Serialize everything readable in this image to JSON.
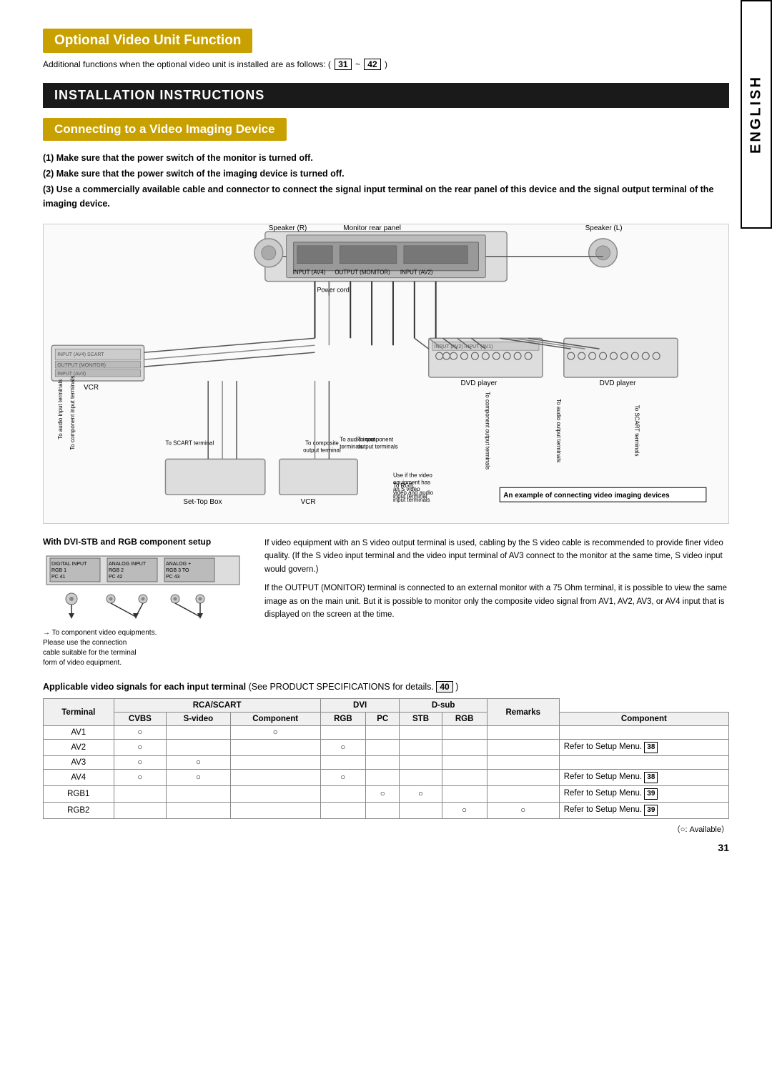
{
  "page": {
    "number": "31",
    "sidebar_label": "ENGLISH"
  },
  "optional_header": {
    "title": "Optional Video Unit Function",
    "subtitle": "Additional functions when the optional video unit is installed are as follows: (",
    "badge1": "31",
    "tilde": " ~ ",
    "badge2": "42",
    "suffix": " )"
  },
  "installation": {
    "title": "INSTALLATION INSTRUCTIONS"
  },
  "connecting": {
    "title": "Connecting to a Video Imaging Device"
  },
  "instructions": [
    "(1) Make sure that the power switch of the monitor is turned off.",
    "(2) Make sure that the power switch of the imaging device is turned off.",
    "(3) Use a commercially available cable and connector to connect the signal input terminal on the rear panel of this device and the signal output terminal of the imaging device."
  ],
  "diagram": {
    "caption": "An example of connecting video imaging devices",
    "labels": {
      "speaker_r": "Speaker (R)",
      "monitor_rear": "Monitor rear panel",
      "speaker_l": "Speaker (L)",
      "power": "Power cord",
      "dvd_player1": "DVD player",
      "dvd_player2": "DVD player",
      "vcr1": "VCR",
      "vcr2": "VCR",
      "set_top_box": "Set-Top Box",
      "to_audio_input": "To audio input terminals",
      "to_component1": "To component input terminals",
      "to_component2": "To component output terminals",
      "to_audio_output": "To audio output terminals",
      "to_scart1": "To SCART terminal",
      "to_scart2": "To SCART terminals",
      "to_rgb": "To RGB, video and audio input terminals",
      "to_composite": "To composite output terminal",
      "to_audio_input2": "To audio input terminals",
      "use_if": "Use if the video equipment has an S video input terminal"
    }
  },
  "dvi_stb": {
    "title": "With DVI-STB and RGB component setup",
    "inputs": [
      {
        "label": "DIGITAL INPUT\nRGB 1\nPC 41"
      },
      {
        "label": "ANALOG INPUT\nRGB 2\nPC 42"
      },
      {
        "label": "ANALOG +\nRGB 3 TO\nPC 43"
      }
    ],
    "component_label": "To component video equipments.\nPlease use the connection\ncable suitable for the terminal\nform of video equipment.",
    "notes": [
      "If video equipment with an S video output terminal is used, cabling by the S video cable is recommended to provide finer video quality. (If the S video input terminal and the video input terminal of AV3 connect to the monitor at the same time, S video input would govern.)",
      "If the OUTPUT (MONITOR) terminal is connected to an external monitor with a 75 Ohm terminal, it is possible to view the same image as on the main unit. But it is possible to monitor only the composite video signal from AV1, AV2, AV3, or AV4 input that is displayed on the screen at the time."
    ]
  },
  "applicable": {
    "text": "Applicable video signals for each input terminal",
    "see": "(See PRODUCT SPECIFICATIONS for details.",
    "badge": "40",
    "suffix": ")"
  },
  "table": {
    "columns": {
      "terminal": "Terminal",
      "rca_scart": "RCA/SCART",
      "dvi": "DVI",
      "dsub": "D-sub",
      "remarks": "Remarks"
    },
    "sub_columns": {
      "cvbs": "CVBS",
      "svideo": "S-video",
      "component": "Component",
      "rgb_rca": "RGB",
      "pc": "PC",
      "stb": "STB",
      "rgb_dsub": "RGB",
      "component_dsub": "Component"
    },
    "rows": [
      {
        "terminal": "AV1",
        "cvbs": "○",
        "svideo": "",
        "component_rca": "○",
        "rgb_rca": "",
        "pc": "",
        "stb": "",
        "rgb_dsub": "",
        "component_dsub": "",
        "remarks": ""
      },
      {
        "terminal": "AV2",
        "cvbs": "○",
        "svideo": "",
        "component_rca": "",
        "rgb_rca": "○",
        "pc": "",
        "stb": "",
        "rgb_dsub": "",
        "component_dsub": "",
        "remarks": "Refer to Setup Menu.",
        "badge": "38"
      },
      {
        "terminal": "AV3",
        "cvbs": "○",
        "svideo": "○",
        "component_rca": "",
        "rgb_rca": "",
        "pc": "",
        "stb": "",
        "rgb_dsub": "",
        "component_dsub": "",
        "remarks": ""
      },
      {
        "terminal": "AV4",
        "cvbs": "○",
        "svideo": "○",
        "component_rca": "",
        "rgb_rca": "○",
        "pc": "",
        "stb": "",
        "rgb_dsub": "",
        "component_dsub": "",
        "remarks": "Refer to Setup Menu.",
        "badge": "38"
      },
      {
        "terminal": "RGB1",
        "cvbs": "",
        "svideo": "",
        "component_rca": "",
        "rgb_rca": "",
        "pc": "○",
        "stb": "○",
        "rgb_dsub": "",
        "component_dsub": "",
        "remarks": "Refer to Setup Menu.",
        "badge": "39"
      },
      {
        "terminal": "RGB2",
        "cvbs": "",
        "svideo": "",
        "component_rca": "",
        "rgb_rca": "",
        "pc": "",
        "stb": "",
        "rgb_dsub": "○",
        "component_dsub": "○",
        "remarks": "Refer to Setup Menu.",
        "badge": "39"
      }
    ],
    "footnote": "（○: Available）"
  }
}
